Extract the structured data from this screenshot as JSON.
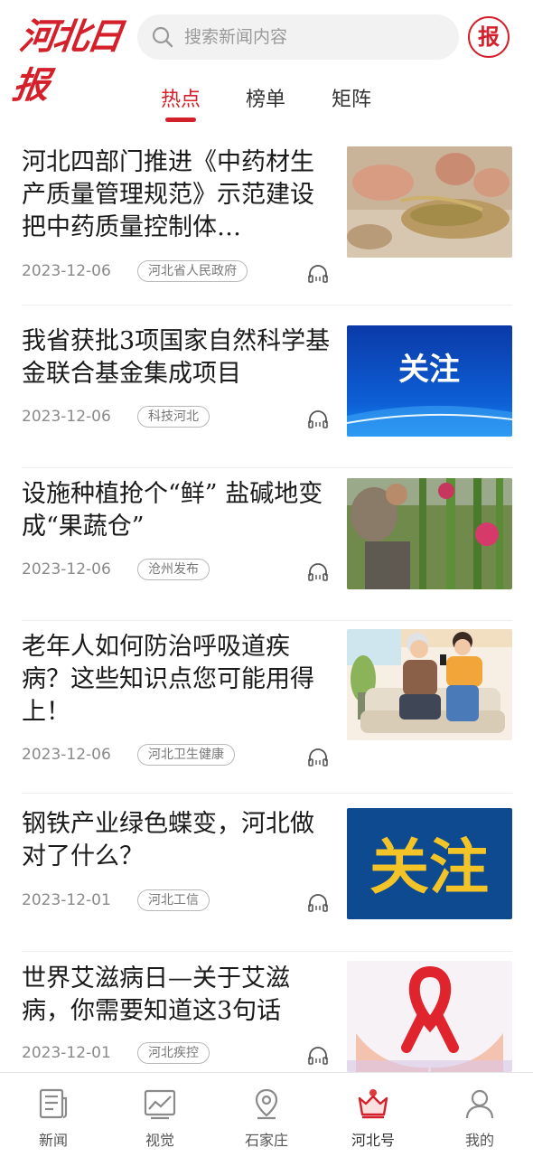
{
  "header": {
    "logo_text": "河北日报",
    "search_placeholder": "搜索新闻内容",
    "paper_button": "报"
  },
  "tabs": [
    {
      "label": "热点",
      "active": true
    },
    {
      "label": "榜单",
      "active": false
    },
    {
      "label": "矩阵",
      "active": false
    }
  ],
  "news": [
    {
      "title": "河北四部门推进《中药材生产质量管理规范》示范建设 把中药质量控制体…",
      "date": "2023-12-06",
      "source": "河北省人民政府",
      "image": "herbs-photo"
    },
    {
      "title": "我省获批3项国家自然科学基金联合基金集成项目",
      "date": "2023-12-06",
      "source": "科技河北",
      "image": "guanzhu-blue-banner",
      "image_text": "关注"
    },
    {
      "title": "设施种植抢个“鲜” 盐碱地变成“果蔬仓”",
      "date": "2023-12-06",
      "source": "沧州发布",
      "image": "dragon-fruit-photo"
    },
    {
      "title": "老年人如何防治呼吸道疾病？这些知识点您可能用得上！",
      "date": "2023-12-06",
      "source": "河北卫生健康",
      "image": "elderly-couple-illustration"
    },
    {
      "title": "钢铁产业绿色蝶变，河北做对了什么？",
      "date": "2023-12-01",
      "source": "河北工信",
      "image": "guanzhu-yellow-banner",
      "image_text": "关注"
    },
    {
      "title": "世界艾滋病日—关于艾滋病，你需要知道这3句话",
      "date": "2023-12-01",
      "source": "河北疾控",
      "image": "red-ribbon-hands"
    }
  ],
  "bottom_nav": [
    {
      "label": "新闻",
      "icon": "newspaper-icon",
      "active": false
    },
    {
      "label": "视觉",
      "icon": "image-chart-icon",
      "active": false
    },
    {
      "label": "石家庄",
      "icon": "location-pin-icon",
      "active": false
    },
    {
      "label": "河北号",
      "icon": "crown-icon",
      "active": true
    },
    {
      "label": "我的",
      "icon": "user-icon",
      "active": false
    }
  ],
  "colors": {
    "brand_red": "#d4202a",
    "text_dark": "#1a1a1a",
    "text_muted": "#8a8a8a"
  }
}
